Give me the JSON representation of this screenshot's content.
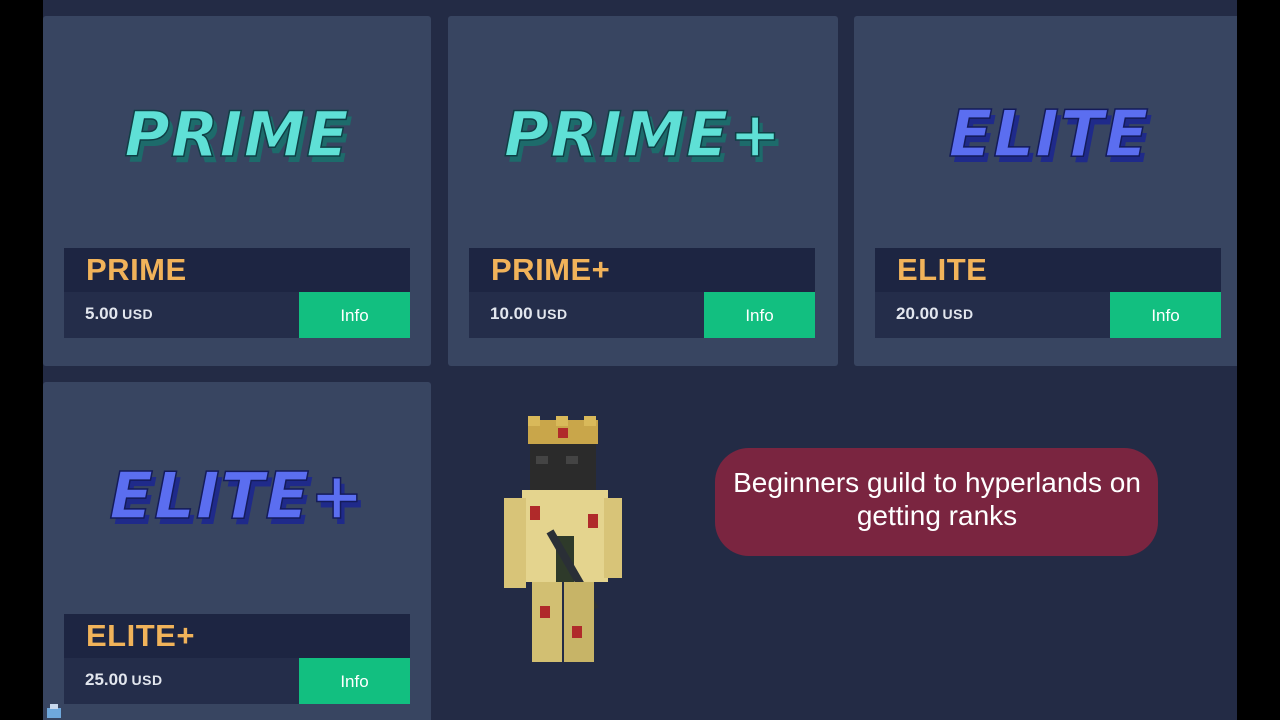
{
  "ranks": [
    {
      "logo": "PRIME",
      "name": "PRIME",
      "price": "5.00",
      "currency": "USD",
      "button": "Info",
      "logo_color": "#5fe0d6"
    },
    {
      "logo": "PRIME+",
      "name": "PRIME+",
      "price": "10.00",
      "currency": "USD",
      "button": "Info",
      "logo_color": "#5fe0d6"
    },
    {
      "logo": "ELITE",
      "name": "ELITE",
      "price": "20.00",
      "currency": "USD",
      "button": "Info",
      "logo_color": "#5b6ef0"
    },
    {
      "logo": "ELITE+",
      "name": "ELITE+",
      "price": "25.00",
      "currency": "USD",
      "button": "Info",
      "logo_color": "#5b6ef0"
    }
  ],
  "caption": {
    "text": "Beginners guild to hyperlands on getting ranks"
  },
  "colors": {
    "background": "#232b45",
    "card": "#384561",
    "rank_name": "#f1b35a",
    "info_button": "#12bf80",
    "caption_bg": "#7a2540"
  }
}
